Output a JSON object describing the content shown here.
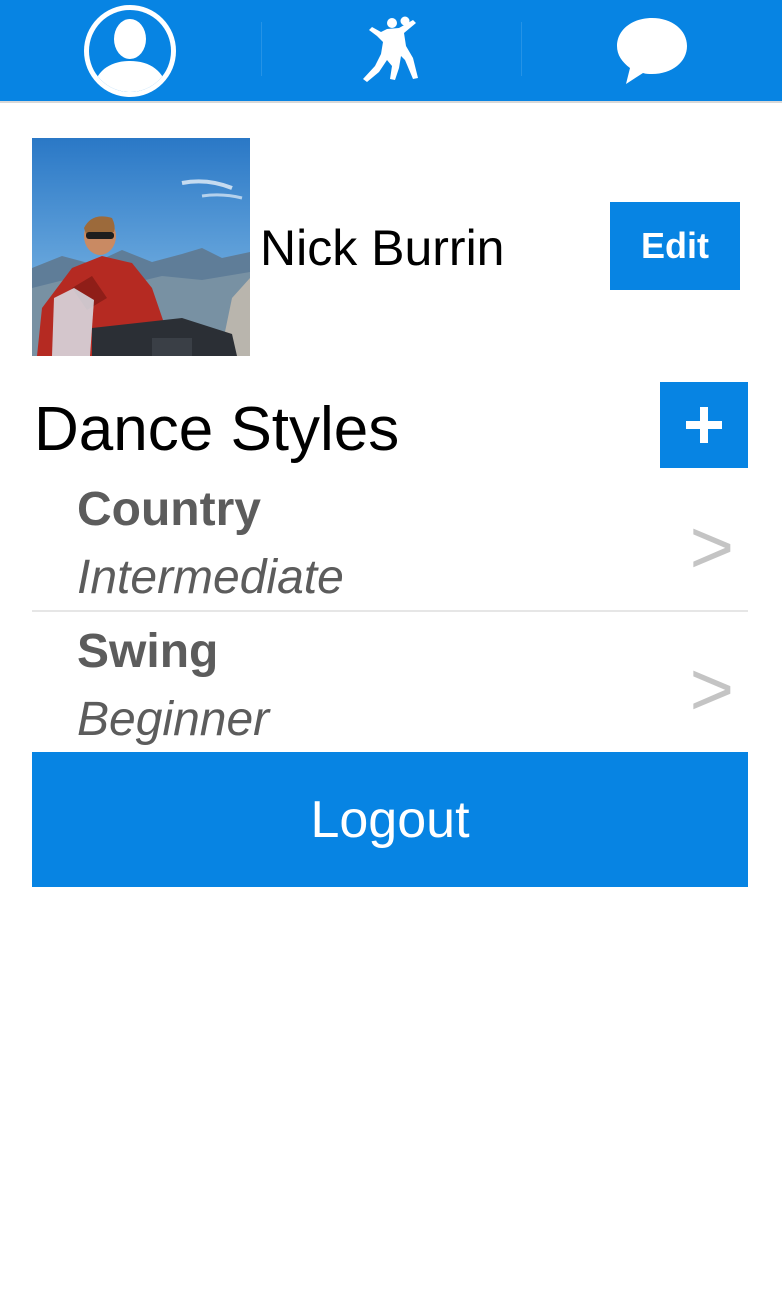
{
  "nav": {
    "tabs": [
      {
        "icon": "profile-icon",
        "active": true
      },
      {
        "icon": "dancers-icon",
        "active": false
      },
      {
        "icon": "chat-icon",
        "active": false
      }
    ],
    "color": "#0784e3"
  },
  "profile": {
    "name": "Nick Burrin",
    "edit_label": "Edit",
    "avatar": "profile-photo"
  },
  "dance_styles": {
    "title": "Dance Styles",
    "add_icon": "plus-icon",
    "items": [
      {
        "name": "Country",
        "level": "Intermediate"
      },
      {
        "name": "Swing",
        "level": "Beginner"
      }
    ],
    "chevron": ">"
  },
  "logout_label": "Logout"
}
